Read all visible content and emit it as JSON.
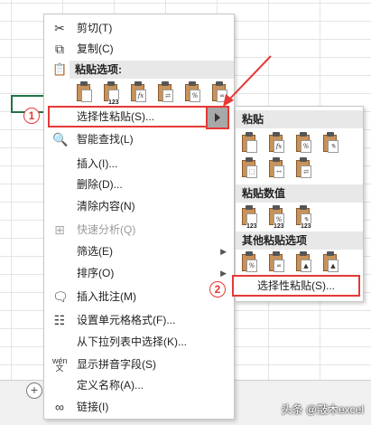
{
  "menu": {
    "cut": "剪切(T)",
    "copy": "复制(C)",
    "paste_options_header": "粘贴选项:",
    "paste_icons": [
      "paste-icon",
      "paste-values-icon",
      "paste-formulas-icon",
      "paste-transpose-icon",
      "paste-formatting-icon",
      "paste-link-icon"
    ],
    "paste_special": "选择性粘贴(S)...",
    "smart_lookup": "智能查找(L)",
    "insert": "插入(I)...",
    "delete": "删除(D)...",
    "clear_contents": "清除内容(N)",
    "quick_analysis": "快速分析(Q)",
    "filter": "筛选(E)",
    "sort": "排序(O)",
    "insert_comment": "插入批注(M)",
    "format_cells": "设置单元格格式(F)...",
    "pick_from_list": "从下拉列表中选择(K)...",
    "phonetic": "显示拼音字段(S)",
    "define_name": "定义名称(A)...",
    "link": "链接(I)"
  },
  "submenu": {
    "paste_header": "粘贴",
    "paste_values_header": "粘贴数值",
    "other_paste_header": "其他粘贴选项",
    "paste_special_option": "选择性粘贴(S)..."
  },
  "callouts": {
    "one": "1",
    "two": "2"
  },
  "sheet": {
    "add_sheet": "+"
  },
  "watermark": "头条 @敲木excel",
  "colors": {
    "accent_red": "#e53935",
    "selection_green": "#217346"
  }
}
